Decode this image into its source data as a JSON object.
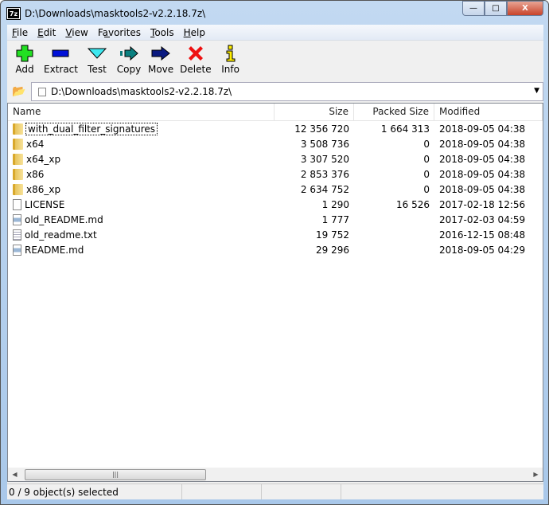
{
  "window": {
    "title": "D:\\Downloads\\masktools2-v2.2.18.7z\\",
    "app_icon": "7z",
    "controls": {
      "minimize": "—",
      "maximize": "□",
      "close": "X"
    }
  },
  "menu": [
    {
      "label": "File",
      "key": "F",
      "rest": "ile"
    },
    {
      "label": "Edit",
      "key": "E",
      "rest": "dit"
    },
    {
      "label": "View",
      "key": "V",
      "rest": "iew"
    },
    {
      "label": "Favorites",
      "key": "a",
      "pre": "F",
      "rest": "vorites"
    },
    {
      "label": "Tools",
      "key": "T",
      "rest": "ools"
    },
    {
      "label": "Help",
      "key": "H",
      "rest": "elp"
    }
  ],
  "toolbar": [
    {
      "label": "Add",
      "icon": "plus-icon"
    },
    {
      "label": "Extract",
      "icon": "minus-icon"
    },
    {
      "label": "Test",
      "icon": "check-icon"
    },
    {
      "label": "Copy",
      "icon": "copy-arrow-icon"
    },
    {
      "label": "Move",
      "icon": "move-arrow-icon"
    },
    {
      "label": "Delete",
      "icon": "x-icon"
    },
    {
      "label": "Info",
      "icon": "info-icon"
    }
  ],
  "address": {
    "path": "D:\\Downloads\\masktools2-v2.2.18.7z\\"
  },
  "columns": [
    "Name",
    "Size",
    "Packed Size",
    "Modified"
  ],
  "rows": [
    {
      "name": "with_dual_filter_signatures",
      "type": "folder",
      "size": "12 356 720",
      "packed": "1 664 313",
      "modified": "2018-09-05 04:38"
    },
    {
      "name": "x64",
      "type": "folder",
      "size": "3 508 736",
      "packed": "0",
      "modified": "2018-09-05 04:38"
    },
    {
      "name": "x64_xp",
      "type": "folder",
      "size": "3 307 520",
      "packed": "0",
      "modified": "2018-09-05 04:38"
    },
    {
      "name": "x86",
      "type": "folder",
      "size": "2 853 376",
      "packed": "0",
      "modified": "2018-09-05 04:38"
    },
    {
      "name": "x86_xp",
      "type": "folder",
      "size": "2 634 752",
      "packed": "0",
      "modified": "2018-09-05 04:38"
    },
    {
      "name": "LICENSE",
      "type": "file",
      "size": "1 290",
      "packed": "16 526",
      "modified": "2017-02-18 12:56"
    },
    {
      "name": "old_README.md",
      "type": "md",
      "size": "1 777",
      "packed": "",
      "modified": "2017-02-03 04:59"
    },
    {
      "name": "old_readme.txt",
      "type": "txt",
      "size": "19 752",
      "packed": "",
      "modified": "2016-12-15 08:48"
    },
    {
      "name": "README.md",
      "type": "md",
      "size": "29 296",
      "packed": "",
      "modified": "2018-09-05 04:29"
    }
  ],
  "status": {
    "selection": "0 / 9 object(s) selected"
  }
}
